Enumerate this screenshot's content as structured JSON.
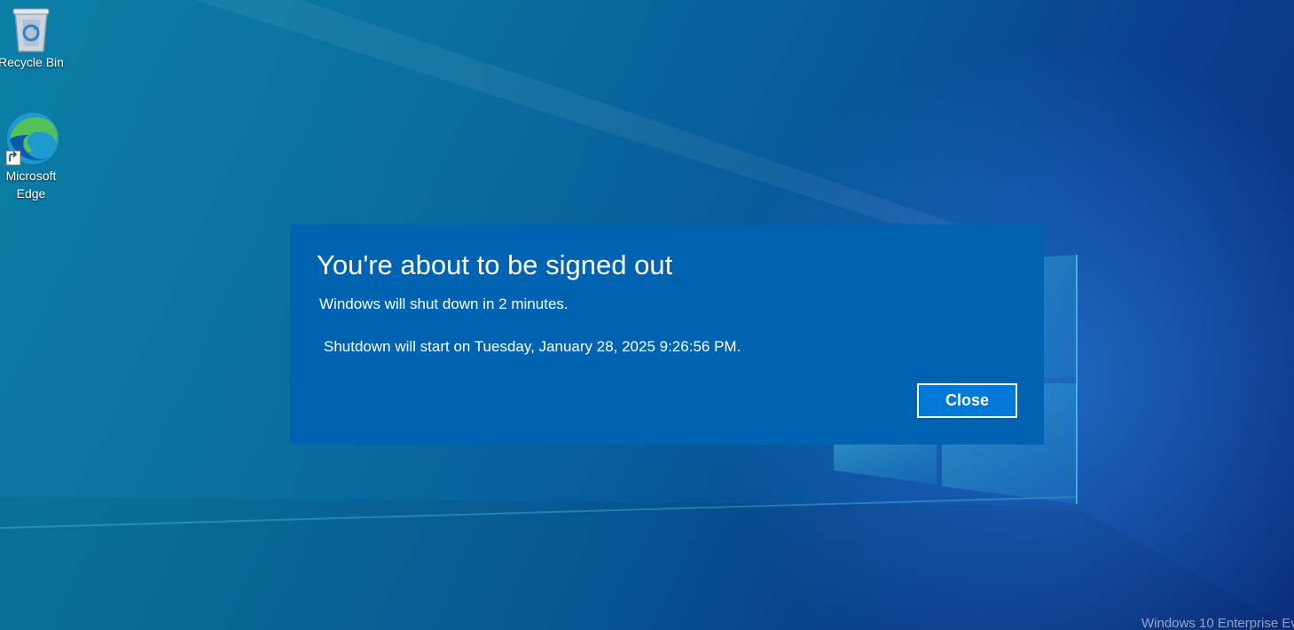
{
  "desktop": {
    "icons": [
      {
        "label": "Recycle Bin",
        "icon": "recycle-bin-icon"
      },
      {
        "label": "Microsoft Edge",
        "icon": "edge-icon",
        "shortcut_overlay": "shortcut-arrow-icon"
      }
    ]
  },
  "dialog": {
    "title": "You're about to be signed out",
    "message": "Windows will shut down in 2 minutes.",
    "detail": "Shutdown will start on Tuesday, January 28, 2025 9:26:56 PM.",
    "close_label": "Close",
    "background_color": "#0063b1",
    "button_color": "#0078d7"
  },
  "watermark": {
    "text": "Windows 10 Enterprise Ev"
  },
  "colors": {
    "desktop_gradient_start": "#0b7fa6",
    "desktop_gradient_end": "#0b2d7c"
  }
}
